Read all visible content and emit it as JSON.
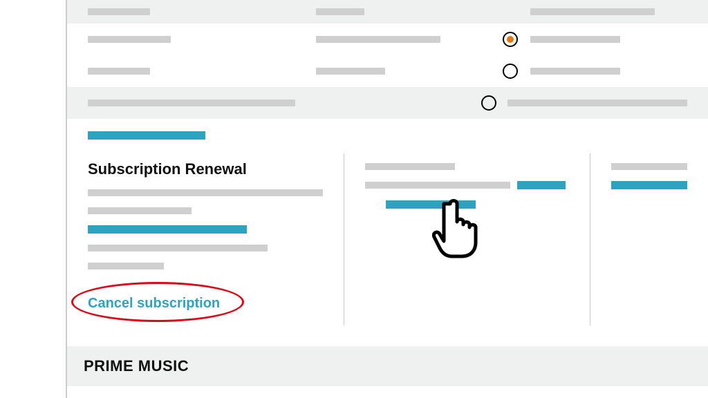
{
  "panel1": {
    "title": "Subscription Renewal",
    "cancel": "Cancel subscription"
  },
  "section_header": "PRIME MUSIC"
}
